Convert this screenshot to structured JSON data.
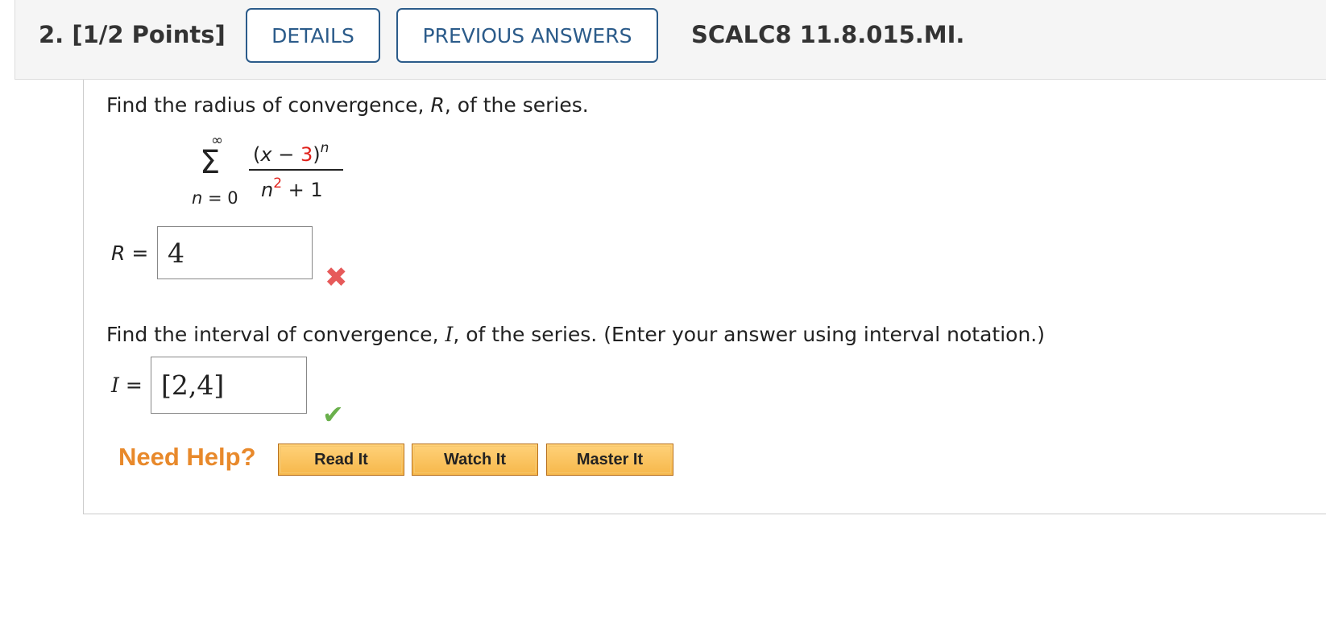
{
  "header": {
    "question_number": "2.",
    "points": "[1/2 Points]",
    "details_label": "DETAILS",
    "previous_answers_label": "PREVIOUS ANSWERS",
    "question_code": "SCALC8 11.8.015.MI."
  },
  "part1": {
    "prompt_start": "Find the radius of convergence, ",
    "prompt_var": "R",
    "prompt_end": ", of the series.",
    "answer_label_var": "R",
    "answer_label_eq": " =",
    "answer_value": "4",
    "status": "incorrect",
    "status_icon": "cross-icon"
  },
  "series": {
    "sum_symbol": "Σ",
    "upper": "∞",
    "lower_var": "n",
    "lower_rest": " = 0",
    "num_open": "(",
    "num_x": "x",
    "num_minus": " − ",
    "num_three": "3",
    "num_close": ")",
    "num_exp": "n",
    "den_n": "n",
    "den_exp": "2",
    "den_rest": " + 1"
  },
  "part2": {
    "prompt_start": "Find the interval of convergence, ",
    "prompt_var": "I",
    "prompt_end": ", of the series. (Enter your answer using interval notation.)",
    "answer_label_var": "I",
    "answer_label_eq": " =",
    "answer_value": "[2,4]",
    "status": "correct",
    "status_icon": "check-icon"
  },
  "help": {
    "label": "Need Help?",
    "read_it": "Read It",
    "watch_it": "Watch It",
    "master_it": "Master It"
  },
  "colors": {
    "accent": "#2b5b8a",
    "need_help": "#e8892b",
    "red_highlight": "#e0201a",
    "incorrect": "#e65a5a",
    "correct": "#6ab04c"
  }
}
